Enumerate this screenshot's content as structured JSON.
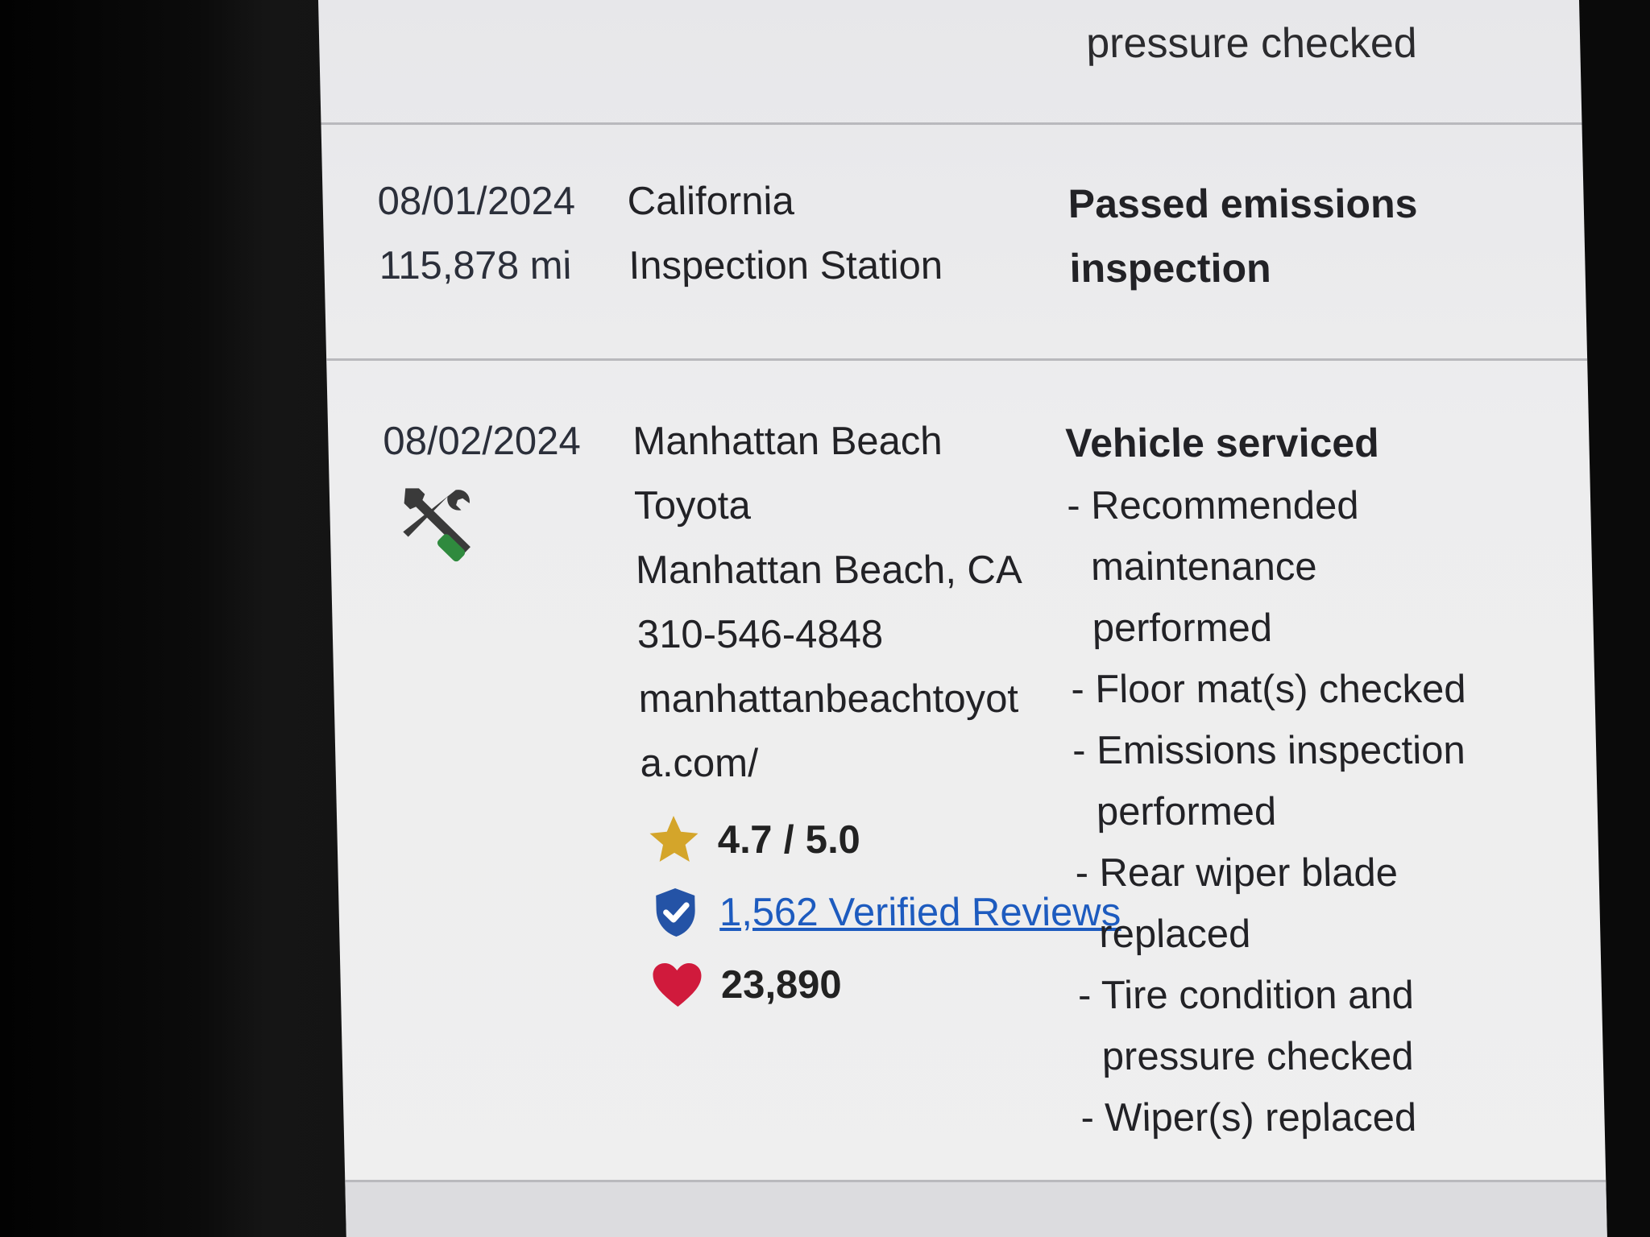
{
  "previous_record": {
    "desc_tail": "pressure checked"
  },
  "records": [
    {
      "date": "08/01/2024",
      "mileage": "115,878 mi",
      "location_lines": [
        "California",
        "Inspection Station"
      ],
      "title_lines": [
        "Passed emissions",
        "inspection"
      ]
    },
    {
      "date": "08/02/2024",
      "location_lines": [
        "Manhattan Beach",
        "Toyota",
        "Manhattan Beach, CA",
        "310-546-4848",
        "manhattanbeachtoyot",
        "a.com/"
      ],
      "title": "Vehicle serviced",
      "items": [
        "- Recommended maintenance performed",
        "- Floor mat(s) checked",
        "- Emissions inspection performed",
        "- Rear wiper blade replaced",
        "- Tire condition and pressure checked",
        "- Wiper(s) replaced"
      ],
      "rating": "4.7 / 5.0",
      "reviews_link": "1,562 Verified Reviews",
      "likes": "23,890",
      "icons": {
        "service": "wrench-screwdriver-icon",
        "rating": "star-icon",
        "verified": "shield-check-icon",
        "likes": "heart-icon"
      }
    }
  ],
  "colors": {
    "star": "#d4a52a",
    "shield": "#2453a6",
    "heart": "#d01a3c",
    "screwdriver_handle": "#2f8a3e",
    "link": "#1d5bbf"
  }
}
